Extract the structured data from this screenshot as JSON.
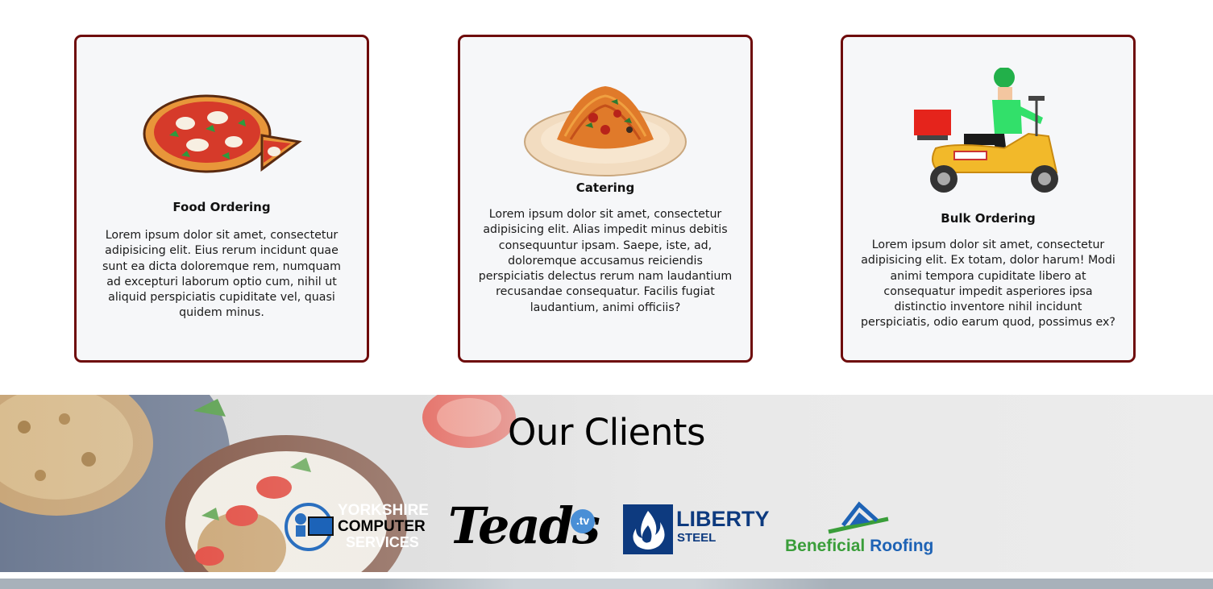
{
  "services": [
    {
      "title": "Food Ordering",
      "text": "Lorem ipsum dolor sit amet, consectetur adipisicing elit. Eius rerum incidunt quae sunt ea dicta doloremque rem, numquam ad excepturi laborum optio cum, nihil ut aliquid perspiciatis cupiditate vel, quasi quidem minus.",
      "icon": "pizza-icon"
    },
    {
      "title": "Catering",
      "text": "Lorem ipsum dolor sit amet, consectetur adipisicing elit. Alias impedit minus debitis consequuntur ipsam. Saepe, iste, ad, doloremque accusamus reiciendis perspiciatis delectus rerum nam laudantium recusandae consequatur. Facilis fugiat laudantium, animi officiis?",
      "icon": "spaghetti-plate-icon"
    },
    {
      "title": "Bulk Ordering",
      "text": "Lorem ipsum dolor sit amet, consectetur adipisicing elit. Ex totam, dolor harum! Modi animi tempora cupiditate libero at consequatur impedit asperiores ipsa distinctio inventore nihil incidunt perspiciatis, odio earum quod, possimus ex?",
      "icon": "delivery-scooter-icon"
    }
  ],
  "clients": {
    "heading": "Our Clients",
    "logos": [
      {
        "name": "yorkshire-computer-services-logo",
        "line1": "YORKSHIRE",
        "line2": "COMPUTER",
        "line3": "SERVICES"
      },
      {
        "name": "teads-logo",
        "word": "Teads",
        "badge": ".tv"
      },
      {
        "name": "liberty-steel-logo",
        "line1": "LIBERTY",
        "line2": "STEEL"
      },
      {
        "name": "beneficial-roofing-logo",
        "word1": "Beneficial",
        "word2": "Roofing"
      }
    ]
  },
  "colors": {
    "card_border": "#6e0b0b",
    "card_bg": "#f6f7f9",
    "liberty_blue": "#0d3a7f",
    "roofing_green": "#3a9e3a",
    "roofing_blue": "#1e63b5"
  }
}
